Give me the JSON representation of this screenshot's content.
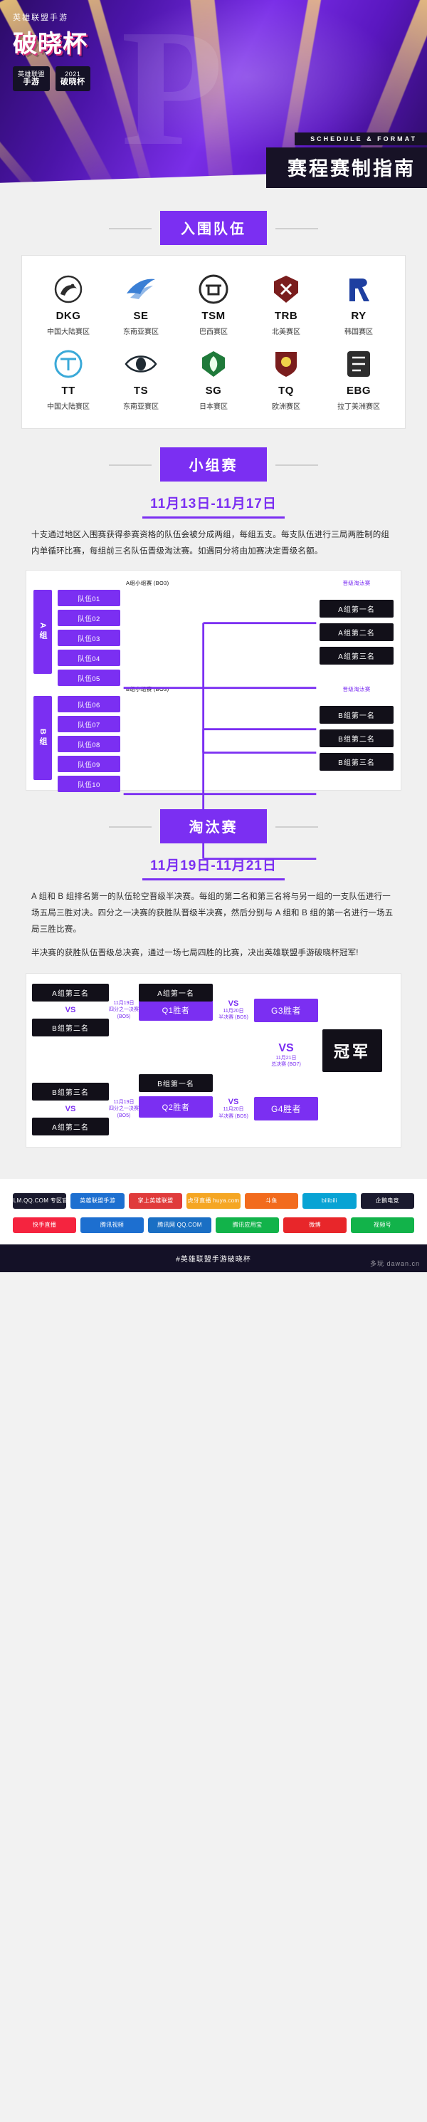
{
  "hero": {
    "top_label": "英雄联盟手游",
    "title_cn": "破晓杯",
    "badge1_top": "英雄联盟",
    "badge1_main": "手游",
    "badge2_top": "2021",
    "badge2_main": "破晓杯",
    "watermark_letter": "P",
    "strap_en": "SCHEDULE & FORMAT",
    "strap_cn": "赛程赛制指南"
  },
  "teams_section": {
    "heading": "入围队伍",
    "teams": [
      {
        "tag": "DKG",
        "region": "中国大陆赛区",
        "icon": "dkg-crest-icon",
        "color": "#2d2d2d"
      },
      {
        "tag": "SE",
        "region": "东南亚赛区",
        "icon": "se-bird-icon",
        "color": "#3a7fd5"
      },
      {
        "tag": "TSM",
        "region": "巴西赛区",
        "icon": "tsm-shield-icon",
        "color": "#2a2a2a"
      },
      {
        "tag": "TRB",
        "region": "北美赛区",
        "icon": "trb-axe-icon",
        "color": "#7a1d1d"
      },
      {
        "tag": "RY",
        "region": "韩国赛区",
        "icon": "ry-wing-icon",
        "color": "#1e3fa0"
      },
      {
        "tag": "TT",
        "region": "中国大陆赛区",
        "icon": "tt-circle-icon",
        "color": "#3aa9d8"
      },
      {
        "tag": "TS",
        "region": "东南亚赛区",
        "icon": "ts-eye-icon",
        "color": "#1f2a33"
      },
      {
        "tag": "SG",
        "region": "日本赛区",
        "icon": "sg-leaf-icon",
        "color": "#1f7a3a"
      },
      {
        "tag": "TQ",
        "region": "欧洲赛区",
        "icon": "tq-crest-icon",
        "color": "#7a1d1d"
      },
      {
        "tag": "EBG",
        "region": "拉丁美洲赛区",
        "icon": "ebg-badge-icon",
        "color": "#2d2d2d"
      }
    ]
  },
  "group_stage": {
    "heading": "小组赛",
    "date": "11月13日-11月17日",
    "paragraphs": [
      "十支通过地区入围赛获得参赛资格的队伍会被分成两组，每组五支。每支队伍进行三局两胜制的组内单循环比赛，每组前三名队伍晋级淘汰赛。如遇同分将由加赛决定晋级名额。"
    ],
    "col_left_caption": "A组小组赛 (BO3)",
    "col_left_caption_b": "B组小组赛 (BO3)",
    "col_right_caption": "晋级淘汰赛",
    "group_a": {
      "label": "A组",
      "teams": [
        "队伍01",
        "队伍02",
        "队伍03",
        "队伍04",
        "队伍05"
      ],
      "outcomes": [
        "A组第一名",
        "A组第二名",
        "A组第三名"
      ]
    },
    "group_b": {
      "label": "B组",
      "teams": [
        "队伍06",
        "队伍07",
        "队伍08",
        "队伍09",
        "队伍10"
      ],
      "outcomes": [
        "B组第一名",
        "B组第二名",
        "B组第三名"
      ]
    }
  },
  "knockout": {
    "heading": "淘汰赛",
    "date": "11月19日-11月21日",
    "paragraphs": [
      "A 组和 B 组排名第一的队伍轮空晋级半决赛。每组的第二名和第三名将与另一组的一支队伍进行一场五局三胜对决。四分之一决赛的获胜队晋级半决赛，然后分别与 A 组和 B 组的第一名进行一场五局三胜比赛。",
      "半决赛的获胜队伍晋级总决赛，通过一场七局四胜的比赛，决出英雄联盟手游破晓杯冠军!"
    ],
    "r1": [
      {
        "top": "A组第三名",
        "bottom": "B组第二名",
        "vs": "VS",
        "note_date": "11月19日",
        "note_text": "四分之一决赛\\n(BO5)",
        "winner": "Q1胜者"
      },
      {
        "top": "B组第三名",
        "bottom": "A组第二名",
        "vs": "VS",
        "note_date": "11月19日",
        "note_text": "四分之一决赛\\n(BO5)",
        "winner": "Q2胜者"
      }
    ],
    "r2": [
      {
        "seed": "A组第一名",
        "vs": "VS",
        "note_date": "11月20日",
        "note_text": "半决赛\\n(BO5)",
        "winner": "G3胜者"
      },
      {
        "seed": "B组第一名",
        "vs": "VS",
        "note_date": "11月20日",
        "note_text": "半决赛\\n(BO5)",
        "winner": "G4胜者"
      }
    ],
    "final": {
      "vs": "VS",
      "note_date": "11月21日",
      "note_text": "总决赛\\n(BO7)",
      "champion": "冠军"
    }
  },
  "footer": {
    "row1": [
      {
        "label": "LOLM.QQ.COM 专区官网",
        "color": "#1a1a2e"
      },
      {
        "label": "英雄联盟手游",
        "color": "#1d6fd0"
      },
      {
        "label": "掌上英雄联盟",
        "color": "#e03b3b"
      },
      {
        "label": "虎牙直播 huya.com",
        "color": "#f5a623"
      },
      {
        "label": "斗鱼",
        "color": "#f26b1d"
      },
      {
        "label": "bilibili",
        "color": "#08a3d4"
      },
      {
        "label": "企鹅电竞",
        "color": "#1a1a2e"
      }
    ],
    "row2": [
      {
        "label": "快手直播",
        "color": "#f5243f"
      },
      {
        "label": "腾讯视频",
        "color": "#1d6fd0"
      },
      {
        "label": "腾讯网 QQ.COM",
        "color": "#1a6fc4"
      },
      {
        "label": "腾讯应用宝",
        "color": "#12b34a"
      },
      {
        "label": "微博",
        "color": "#e8262a"
      },
      {
        "label": "视频号",
        "color": "#12b34a"
      }
    ],
    "hashtag": "#英雄联盟手游破晓杯",
    "watermark": "多玩 dawan.cn"
  }
}
